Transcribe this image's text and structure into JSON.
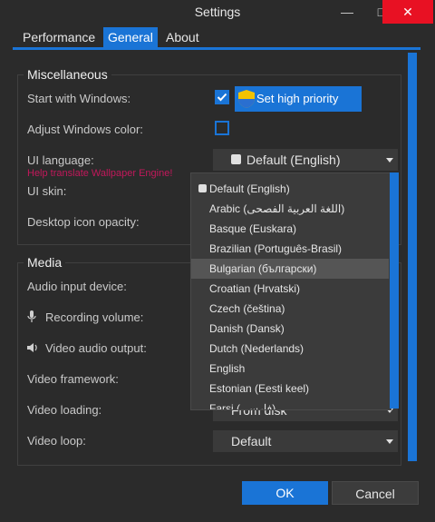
{
  "window": {
    "title": "Settings",
    "minimize_icon": "minimize-icon",
    "maximize_icon": "maximize-icon",
    "close_icon": "close-icon"
  },
  "tabs": [
    {
      "label": "Performance",
      "active": false
    },
    {
      "label": "General",
      "active": true
    },
    {
      "label": "About",
      "active": false
    }
  ],
  "miscellaneous": {
    "title": "Miscellaneous",
    "start_with_windows": {
      "label": "Start with Windows:",
      "checked": true
    },
    "set_high_priority": {
      "label": "Set high priority"
    },
    "adjust_windows_color": {
      "label": "Adjust Windows color:",
      "checked": false
    },
    "ui_language": {
      "label": "UI language:",
      "value": "Default (English)"
    },
    "help_translate": "Help translate Wallpaper Engine!",
    "ui_skin": {
      "label": "UI skin:"
    },
    "desktop_icon_opacity": {
      "label": "Desktop icon opacity:"
    }
  },
  "media": {
    "title": "Media",
    "audio_input_device": {
      "label": "Audio input device:"
    },
    "recording_volume": {
      "label": "Recording volume:"
    },
    "video_audio_output": {
      "label": "Video audio output:"
    },
    "video_framework": {
      "label": "Video framework:"
    },
    "video_loading": {
      "label": "Video loading:",
      "value": "From disk"
    },
    "video_loop": {
      "label": "Video loop:",
      "value": "Default"
    }
  },
  "language_dropdown": {
    "selected": "Bulgarian (български)",
    "items": [
      "Default (English)",
      "Arabic (اللغة العربية الفصحى)",
      "Basque (Euskara)",
      "Brazilian (Português-Brasil)",
      "Bulgarian (български)",
      "Croatian (Hrvatski)",
      "Czech (čeština)",
      "Danish (Dansk)",
      "Dutch (Nederlands)",
      "English",
      "Estonian (Eesti keel)",
      "Farsi (فارسی)"
    ]
  },
  "buttons": {
    "ok": "OK",
    "cancel": "Cancel"
  },
  "colors": {
    "accent": "#1a74d6",
    "background": "#2b2b2b",
    "close_red": "#e81123",
    "help_link": "#c2185b"
  }
}
